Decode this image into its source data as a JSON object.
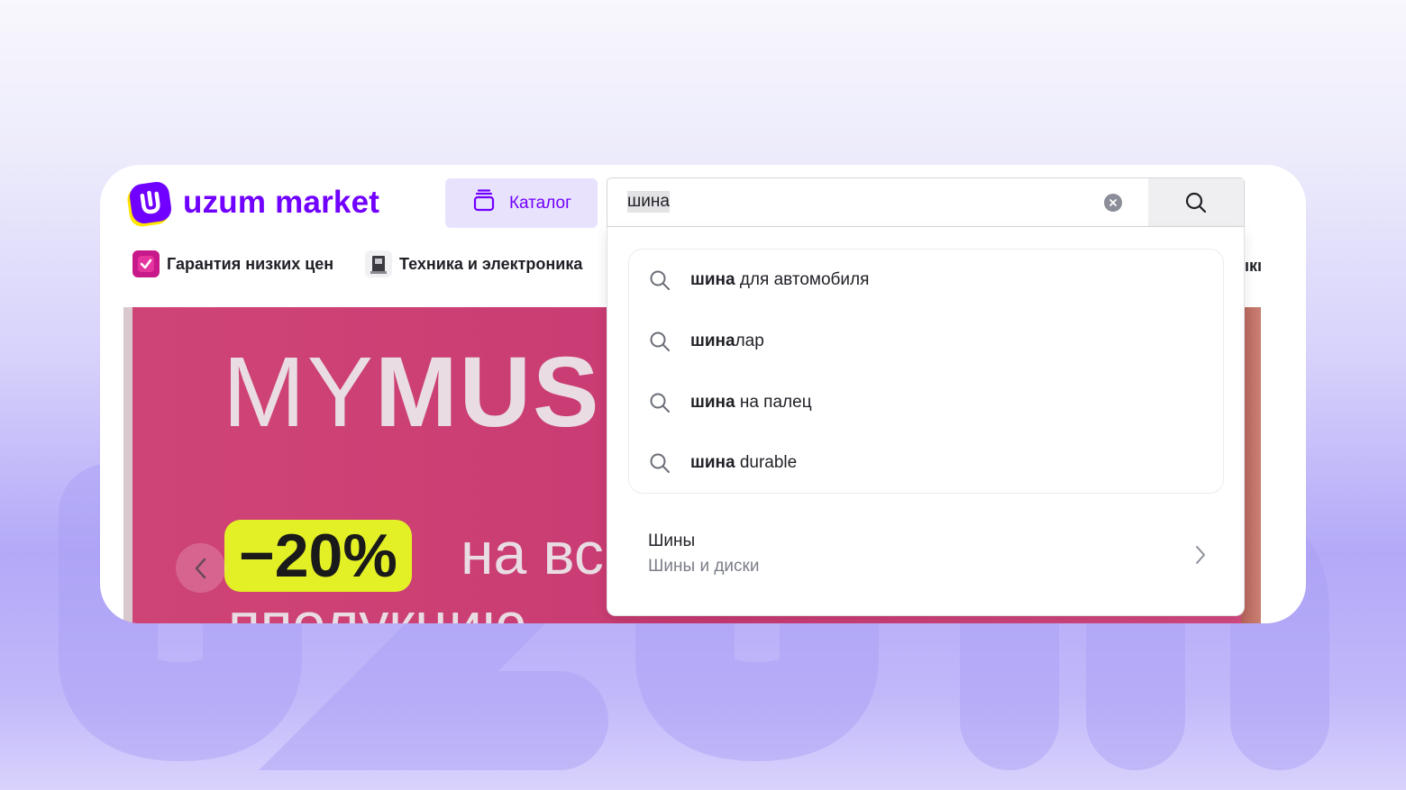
{
  "brand": {
    "name": "uzum market",
    "color": "#7000ff",
    "accent": "#ffe500"
  },
  "header": {
    "catalog_label": "Каталог",
    "search": {
      "value": "шина",
      "placeholder": ""
    }
  },
  "quick_links": [
    {
      "label": "Гарантия низких цен",
      "icon": "checkmark-icon"
    },
    {
      "label": "Техника и электроника",
      "icon": "appliance-icon"
    },
    {
      "label": "ıкı",
      "icon": ""
    }
  ],
  "suggestions": [
    {
      "bold": "шина",
      "rest": " для автомобиля"
    },
    {
      "bold": "шина",
      "rest": "лар"
    },
    {
      "bold": "шина",
      "rest": " на палец"
    },
    {
      "bold": "шина",
      "rest": " durable"
    }
  ],
  "category_suggestion": {
    "title": "Шины",
    "subtitle": "Шины и диски"
  },
  "banner": {
    "title_light": "MY",
    "title_bold": "MUS",
    "discount": "−20%",
    "subtitle": "на вс",
    "subtitle_line2": "пполукцию",
    "background": "#c93f76",
    "discount_color": "#e4f026"
  }
}
